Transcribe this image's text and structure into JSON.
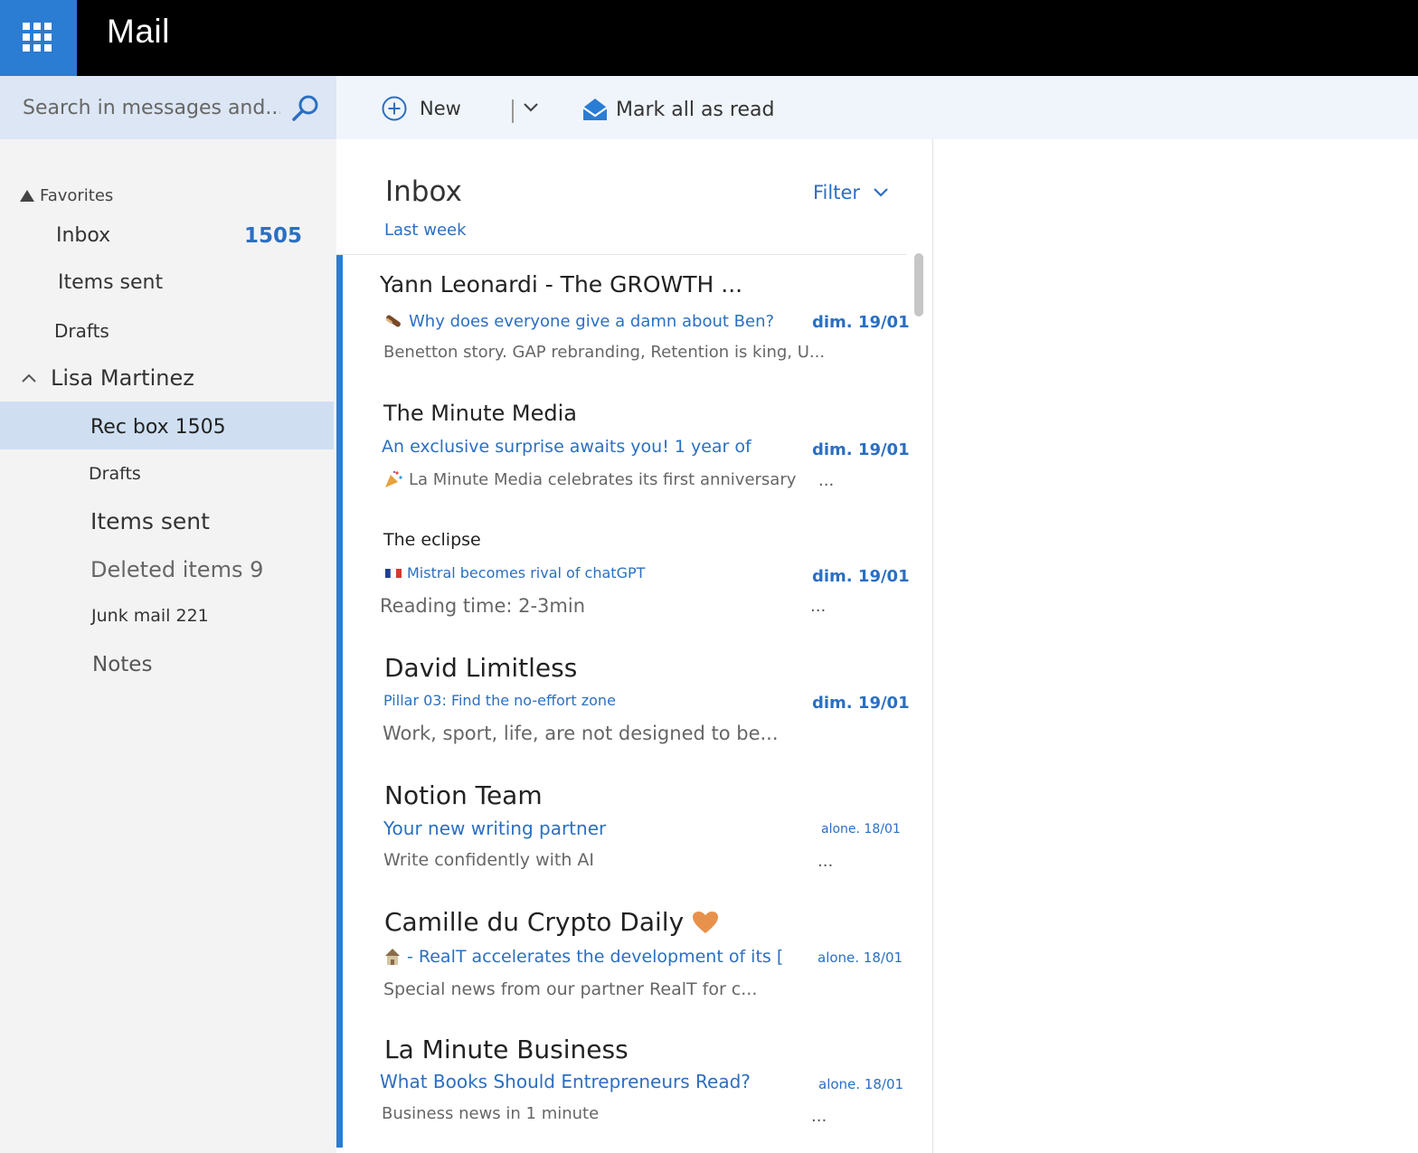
{
  "app": {
    "title": "Mail"
  },
  "search": {
    "placeholder": "Search in messages and..."
  },
  "toolbar": {
    "new_label": "New",
    "mark_all_read_label": "Mark all as read"
  },
  "sidebar": {
    "favorites_label": "Favorites",
    "favorites": [
      {
        "label": "Inbox",
        "count": "1505"
      },
      {
        "label": "Items sent"
      },
      {
        "label": "Drafts"
      }
    ],
    "account_name": "Lisa Martinez",
    "folders": [
      {
        "label": "Rec box 1505"
      },
      {
        "label": "Drafts"
      },
      {
        "label": "Items sent"
      },
      {
        "label": "Deleted items 9"
      },
      {
        "label": "Junk mail 221"
      },
      {
        "label": "Notes"
      }
    ]
  },
  "list": {
    "title": "Inbox",
    "filter_label": "Filter",
    "group_label": "Last week",
    "messages": [
      {
        "sender": "Yann Leonardi - The GROWTH ...",
        "subject": "Why does everyone give a damn about Ben?",
        "subject_icon": "ice-cream-icon",
        "date": "dim. 19/01",
        "preview": "Benetton story. GAP rebranding, Retention is king, U...",
        "ellipsis": ""
      },
      {
        "sender": "The Minute Media",
        "subject": "An exclusive surprise awaits you! 1 year of",
        "date": "dim. 19/01",
        "preview": "La Minute Media celebrates its first anniversary",
        "preview_icon": "party-popper-icon",
        "ellipsis": "..."
      },
      {
        "sender": "The eclipse",
        "subject": "Mistral becomes rival of chatGPT",
        "subject_icon": "french-flag-icon",
        "date": "dim. 19/01",
        "preview": "Reading time: 2-3min",
        "ellipsis": "..."
      },
      {
        "sender": "David Limitless",
        "subject": "Pillar 03: Find the no-effort zone",
        "date": "dim. 19/01",
        "preview": "Work, sport, life, are not designed to be...",
        "ellipsis": ""
      },
      {
        "sender": "Notion Team",
        "subject": "Your new writing partner",
        "date": "alone. 18/01",
        "preview": "Write confidently with AI",
        "ellipsis": "..."
      },
      {
        "sender": "Camille du Crypto Daily",
        "sender_icon": "orange-heart-icon",
        "subject": "- RealT accelerates the development of its [",
        "subject_icon": "house-icon",
        "date": "alone. 18/01",
        "preview": "Special news from our partner RealT for c...",
        "ellipsis": ""
      },
      {
        "sender": "La Minute Business",
        "subject": "What Books Should Entrepreneurs Read?",
        "date": "alone. 18/01",
        "preview": "Business news in 1 minute",
        "ellipsis": "..."
      }
    ]
  },
  "colors": {
    "accent": "#2b7cd3",
    "link": "#2b6fc2",
    "topbar": "#000000",
    "sidebar_bg": "#f3f3f3",
    "selected_bg": "#cfdff1"
  }
}
